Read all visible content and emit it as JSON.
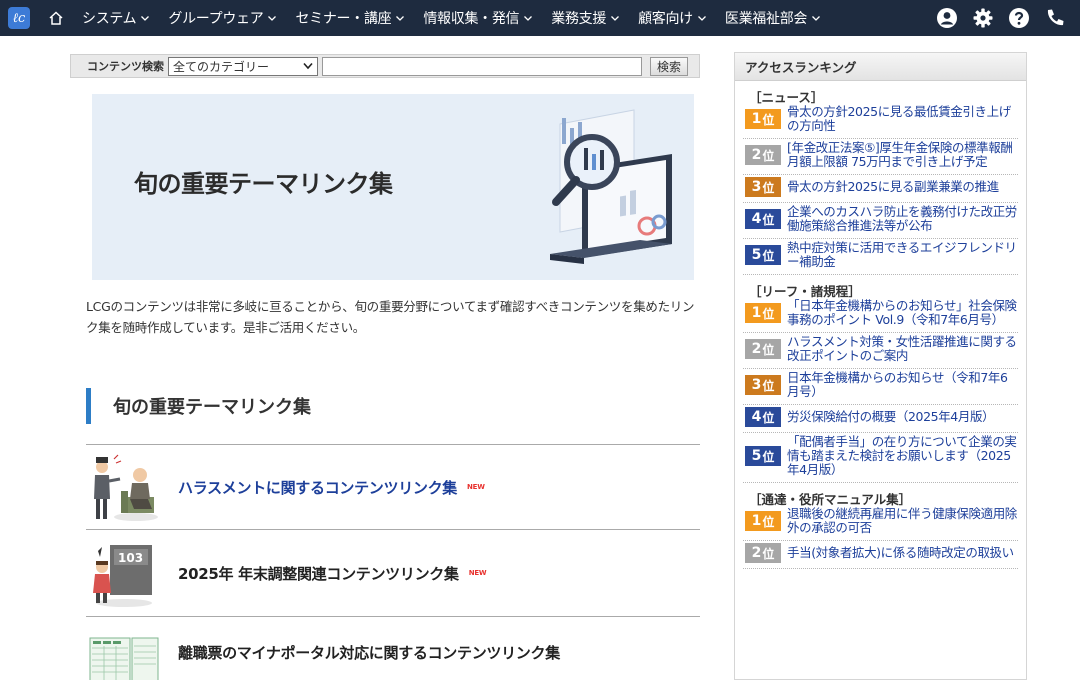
{
  "nav": {
    "logo": "ℓc",
    "items": [
      {
        "label": "システム"
      },
      {
        "label": "グループウェア"
      },
      {
        "label": "セミナー・講座"
      },
      {
        "label": "情報収集・発信"
      },
      {
        "label": "業務支援"
      },
      {
        "label": "顧客向け"
      },
      {
        "label": "医業福祉部会"
      }
    ],
    "icons": [
      "user-icon",
      "gear-icon",
      "help-icon",
      "phone-icon"
    ]
  },
  "search": {
    "label": "コンテンツ検索",
    "category": "全てのカテゴリー",
    "value": "",
    "button": "検索"
  },
  "hero": {
    "title": "旬の重要テーマリンク集"
  },
  "intro": "LCGのコンテンツは非常に多岐に亘ることから、旬の重要分野についてまず確認すべきコンテンツを集めたリンク集を随時作成しています。是非ご活用ください。",
  "section": {
    "title": "旬の重要テーマリンク集",
    "links": [
      {
        "title": "ハラスメントに関するコンテンツリンク集",
        "badge": "NEW"
      },
      {
        "title": "2025年 年末調整関連コンテンツリンク集",
        "badge": "NEW"
      },
      {
        "title": "離職票のマイナポータル対応に関するコンテンツリンク集",
        "badge": ""
      }
    ]
  },
  "ranking": {
    "header": "アクセスランキング",
    "categories": [
      {
        "name": "［ニュース］",
        "items": [
          {
            "rank": "1",
            "suffix": "位",
            "text": "骨太の方針2025に見る最低賃金引き上げの方向性"
          },
          {
            "rank": "2",
            "suffix": "位",
            "text": "[年金改正法案⑤]厚生年金保険の標準報酬月額上限額 75万円まで引き上げ予定"
          },
          {
            "rank": "3",
            "suffix": "位",
            "text": "骨太の方針2025に見る副業兼業の推進"
          },
          {
            "rank": "4",
            "suffix": "位",
            "text": "企業へのカスハラ防止を義務付けた改正労働施策総合推進法等が公布"
          },
          {
            "rank": "5",
            "suffix": "位",
            "text": "熱中症対策に活用できるエイジフレンドリー補助金"
          }
        ]
      },
      {
        "name": "［リーフ・諸規程］",
        "items": [
          {
            "rank": "1",
            "suffix": "位",
            "text": "「日本年金機構からのお知らせ」社会保険事務のポイント Vol.9（令和7年6月号）"
          },
          {
            "rank": "2",
            "suffix": "位",
            "text": "ハラスメント対策・女性活躍推進に関する改正ポイントのご案内"
          },
          {
            "rank": "3",
            "suffix": "位",
            "text": "日本年金機構からのお知らせ（令和7年6月号）"
          },
          {
            "rank": "4",
            "suffix": "位",
            "text": "労災保険給付の概要（2025年4月版）"
          },
          {
            "rank": "5",
            "suffix": "位",
            "text": "「配偶者手当」の在り方について企業の実情も踏まえた検討をお願いします（2025年4月版）"
          }
        ]
      },
      {
        "name": "［通達・役所マニュアル集］",
        "items": [
          {
            "rank": "1",
            "suffix": "位",
            "text": "退職後の継続再雇用に伴う健康保険適用除外の承認の可否"
          },
          {
            "rank": "2",
            "suffix": "位",
            "text": "手当(対象者拡大)に係る随時改定の取扱い"
          }
        ]
      }
    ],
    "badge_colors": {
      "1": "#f39a1e",
      "2": "#a6a6a6",
      "3": "#cc7a1e",
      "4": "#2a4a9a",
      "5": "#2a4a9a"
    }
  }
}
